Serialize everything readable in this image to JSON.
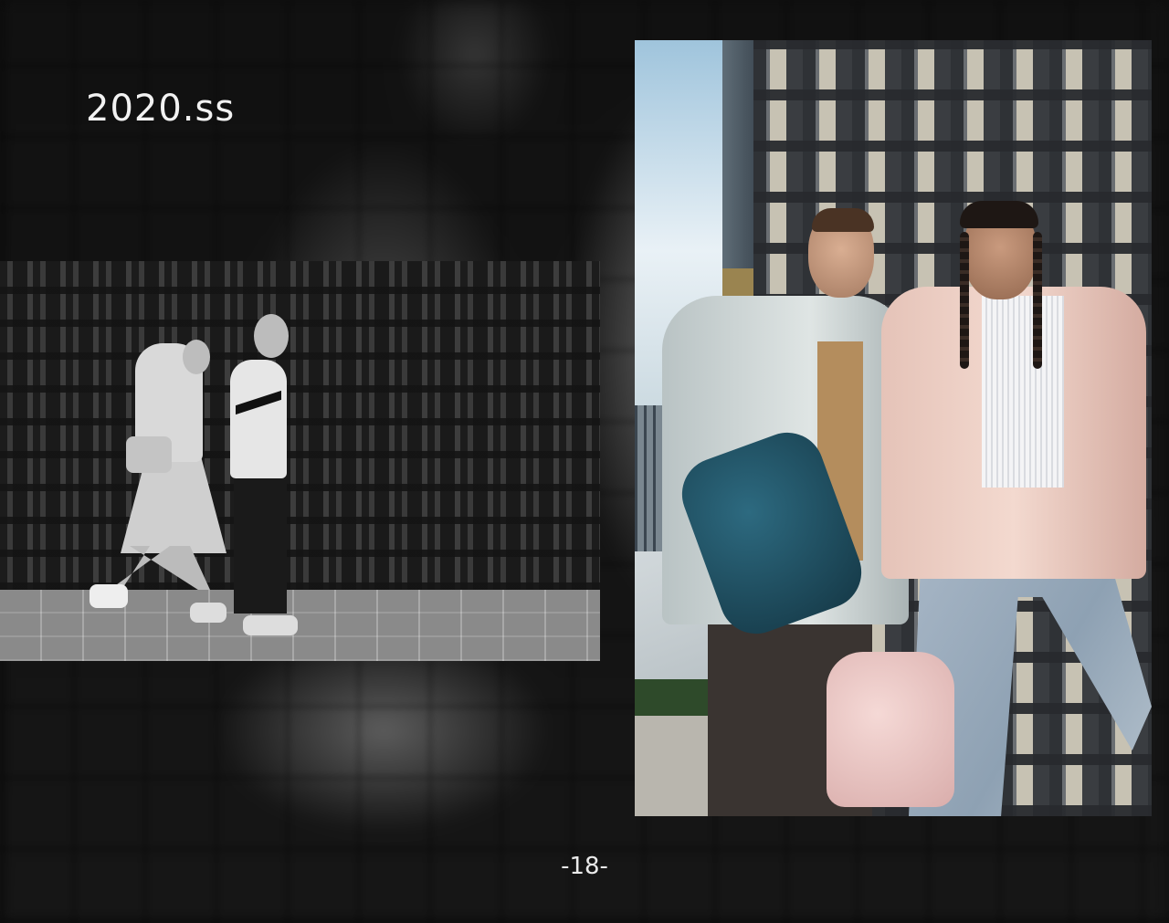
{
  "page": {
    "title": "2020.ss",
    "page_number": "-18-"
  },
  "photos": {
    "left": {
      "label": ""
    },
    "right": {
      "label": ""
    }
  },
  "colors": {
    "background": "#0d0d0d",
    "text": "#f2f2f2"
  }
}
